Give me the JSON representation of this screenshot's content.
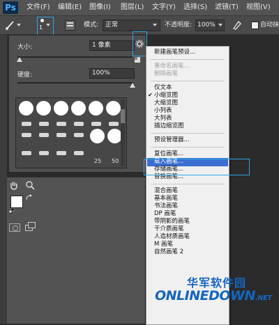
{
  "app": {
    "logo": "Ps"
  },
  "menubar": {
    "items": [
      "文件(F)",
      "编辑(E)",
      "图像(I)",
      "图层(L)",
      "文字(Y)",
      "选择(S)",
      "滤镜(T)",
      "视图(V)"
    ]
  },
  "options_bar": {
    "brush_size_value": "1",
    "mode_label": "模式:",
    "mode_value": "正常",
    "opacity_label": "不透明度:",
    "opacity_value": "100%",
    "auto_label": "自动抹"
  },
  "brush_panel": {
    "size_label": "大小:",
    "size_value": "1 像素",
    "hardness_label": "硬度:",
    "hardness_value": "100%",
    "size_level": 0.02,
    "hardness_level": 1.0,
    "brush_numbers": [
      "25",
      "50"
    ]
  },
  "context_menu": {
    "items": [
      {
        "label": "新建画笔预设...",
        "disabled": false,
        "checked": false
      },
      {
        "label": "重命名画笔...",
        "disabled": true,
        "checked": false
      },
      {
        "label": "删除画笔",
        "disabled": true,
        "checked": false
      },
      {
        "label": "仅文本",
        "disabled": false,
        "checked": false
      },
      {
        "label": "小缩览图",
        "disabled": false,
        "checked": true
      },
      {
        "label": "大缩览图",
        "disabled": false,
        "checked": false
      },
      {
        "label": "小列表",
        "disabled": false,
        "checked": false
      },
      {
        "label": "大列表",
        "disabled": false,
        "checked": false
      },
      {
        "label": "描边缩览图",
        "disabled": false,
        "checked": false
      },
      {
        "label": "预设管理器...",
        "disabled": false,
        "checked": false
      },
      {
        "label": "复位画笔...",
        "disabled": false,
        "checked": false
      },
      {
        "label": "载入画笔...",
        "disabled": false,
        "checked": false,
        "highlighted": true
      },
      {
        "label": "存储画笔...",
        "disabled": false,
        "checked": false
      },
      {
        "label": "替换画笔...",
        "disabled": false,
        "checked": false
      },
      {
        "label": "混合画笔",
        "disabled": false,
        "checked": false
      },
      {
        "label": "基本画笔",
        "disabled": false,
        "checked": false
      },
      {
        "label": "书法画笔",
        "disabled": false,
        "checked": false
      },
      {
        "label": "DP 画笔",
        "disabled": false,
        "checked": false
      },
      {
        "label": "带阴影的画笔",
        "disabled": false,
        "checked": false
      },
      {
        "label": "干介质画笔",
        "disabled": false,
        "checked": false
      },
      {
        "label": "人造材质画笔",
        "disabled": false,
        "checked": false
      },
      {
        "label": "M 画笔",
        "disabled": false,
        "checked": false
      },
      {
        "label": "自然画笔 2",
        "disabled": false,
        "checked": false
      }
    ]
  },
  "watermark": {
    "chinese": "华军软件园",
    "logo_text": "ONLINEDOWN",
    "logo_suffix": ".NET"
  },
  "colors": {
    "highlight": "#3a6fd0",
    "annotation_box": "#2ea7e0",
    "watermark": "#1565c0"
  }
}
